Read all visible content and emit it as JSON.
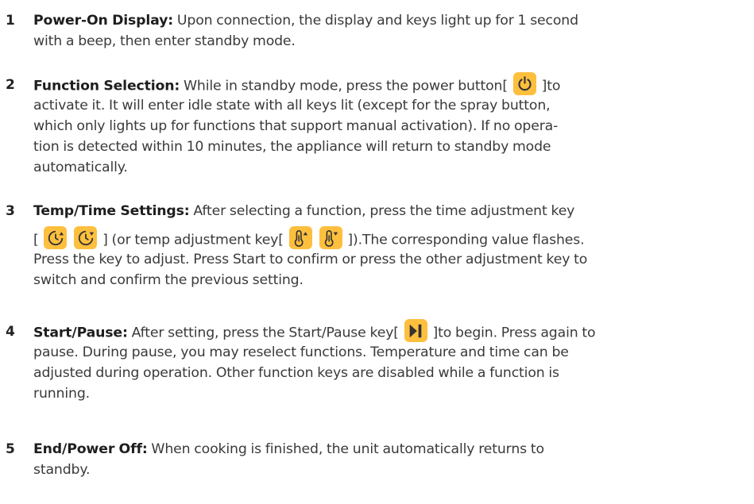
{
  "steps": [
    {
      "number": "1",
      "title": "Power-On Display:",
      "lines": [
        " Upon connection, the display and keys light up for 1 second",
        "with a beep, then enter standby mode."
      ]
    },
    {
      "number": "2",
      "title": "Function Selection:",
      "line1_pre": " While in standby mode, press the power button[ ",
      "line1_post": " ]to",
      "lines": [
        "activate it. It will enter idle state with all keys lit (except for the spray button,",
        "which only lights up for functions that support manual activation). If no opera-",
        "tion is detected within 10 minutes, the appliance will return to standby mode",
        "automatically."
      ]
    },
    {
      "number": "3",
      "title": "Temp/Time Settings:",
      "line1_rest": " After selecting a function, press the time adjustment key",
      "line2_open": "[ ",
      "line2_mid": " ] (or temp adjustment key[ ",
      "line2_post": " ]).The corresponding value flashes.",
      "lines": [
        "Press the key to adjust. Press Start to confirm or press the other adjustment key to",
        "switch and confirm the previous setting."
      ]
    },
    {
      "number": "4",
      "title": "Start/Pause:",
      "line1_pre": " After setting, press the Start/Pause key[ ",
      "line1_post": " ]to begin. Press again to",
      "lines": [
        "pause. During pause, you may reselect functions. Temperature and time can be",
        "adjusted during operation. Other function keys are disabled while a function is",
        "running."
      ]
    },
    {
      "number": "5",
      "title": "End/Power Off:",
      "lines": [
        " When cooking is finished, the unit automatically returns to",
        "standby."
      ]
    }
  ],
  "icons": {
    "color": "#fdbf3e",
    "power": "power-icon",
    "time_up": "time-up-icon",
    "time_down": "time-down-icon",
    "temp_up": "temp-up-icon",
    "temp_down": "temp-down-icon",
    "start_pause": "start-pause-icon"
  }
}
